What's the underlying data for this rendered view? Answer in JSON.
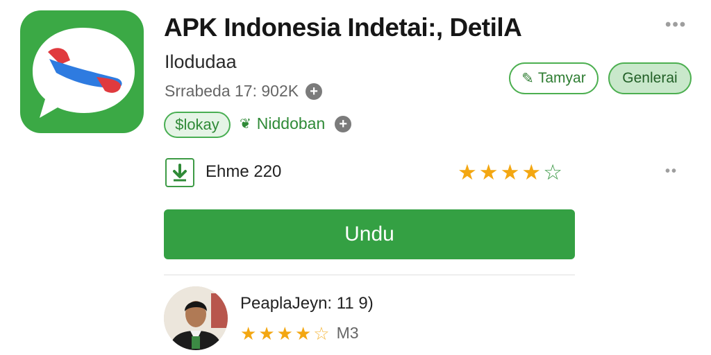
{
  "app": {
    "title": "APK Indonesia Indetai:, DetilA",
    "developer": "Ilodudaa",
    "meta": "Srrabeda 17: 902K",
    "badge": "$lokay",
    "tag": "Niddoban"
  },
  "actions": {
    "outline_button": "Tamyar",
    "fill_button": "Genlerai"
  },
  "stats": {
    "downloads": "Ehme 220",
    "rating": 4,
    "rating_max": 5
  },
  "install": {
    "label": "Undu"
  },
  "review": {
    "name": "PeaplaJeyn: 11  9)",
    "rating": 4.5,
    "rating_max": 5,
    "meta": "M3"
  },
  "icons": [
    "chat-bubble-icon",
    "plus-circle-icon",
    "leaf-icon",
    "pencil-icon",
    "download-icon",
    "star-icon",
    "more-dots-icon"
  ],
  "colors": {
    "accent_green": "#34a043",
    "star": "#f3a712",
    "light_green": "#c9e8cb"
  }
}
